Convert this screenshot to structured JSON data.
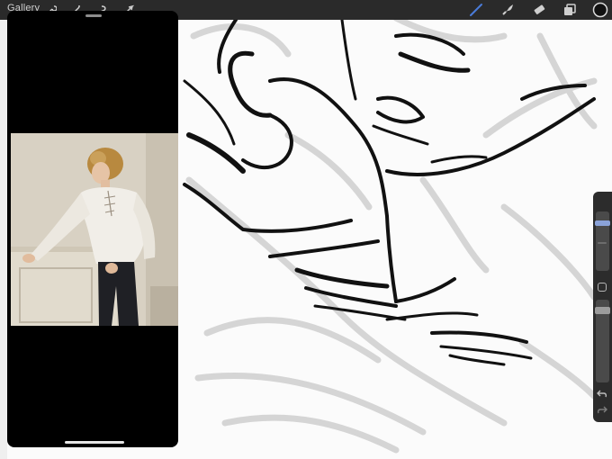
{
  "toolbar": {
    "gallery_label": "Gallery",
    "left_tools": [
      "wrench-icon",
      "magic-wand-icon",
      "selection-icon",
      "transform-arrow-icon"
    ],
    "right_tools": [
      "brush-icon",
      "smudge-icon",
      "eraser-icon",
      "layers-icon",
      "color-swatch"
    ],
    "active_tool": "brush-icon",
    "active_color": "#1a1a1a",
    "brush_color_accent": "#4a7bd9"
  },
  "reference": {
    "photo_description_icon": "reference-photo"
  },
  "sidebar": {
    "brush_size": 0.15,
    "opacity": 0.1,
    "undo_icon": "undo-icon",
    "redo_icon": "redo-icon"
  }
}
